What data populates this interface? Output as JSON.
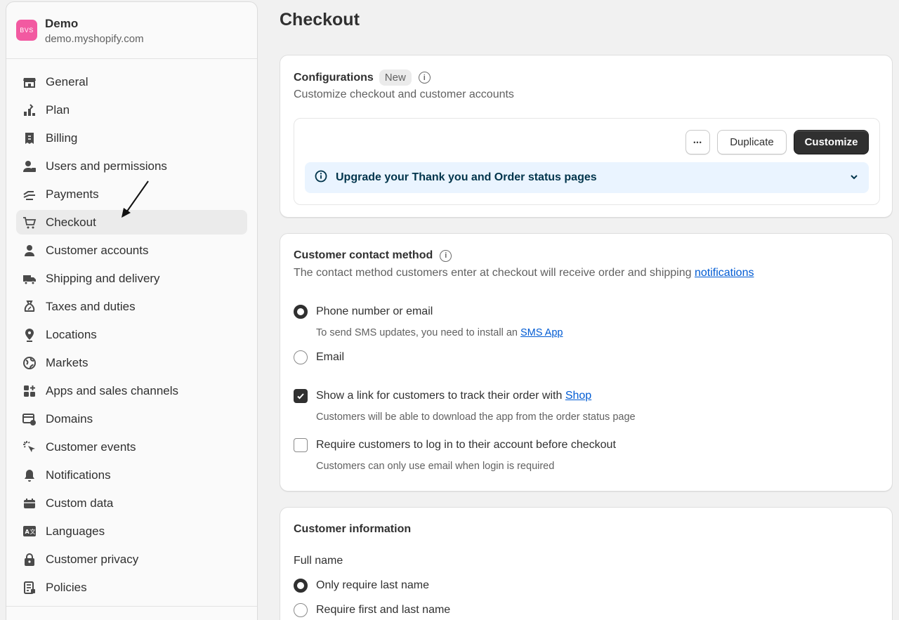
{
  "store": {
    "avatar_text": "BVS",
    "name": "Demo",
    "domain": "demo.myshopify.com",
    "avatar_color": "#f25aa1"
  },
  "sidebar": {
    "items": [
      {
        "label": "General",
        "icon": "store-icon"
      },
      {
        "label": "Plan",
        "icon": "plan-icon"
      },
      {
        "label": "Billing",
        "icon": "billing-icon"
      },
      {
        "label": "Users and permissions",
        "icon": "users-icon"
      },
      {
        "label": "Payments",
        "icon": "payments-icon"
      },
      {
        "label": "Checkout",
        "icon": "cart-icon",
        "active": true
      },
      {
        "label": "Customer accounts",
        "icon": "person-icon"
      },
      {
        "label": "Shipping and delivery",
        "icon": "truck-icon"
      },
      {
        "label": "Taxes and duties",
        "icon": "tax-icon"
      },
      {
        "label": "Locations",
        "icon": "location-icon"
      },
      {
        "label": "Markets",
        "icon": "globe-icon"
      },
      {
        "label": "Apps and sales channels",
        "icon": "apps-icon"
      },
      {
        "label": "Domains",
        "icon": "domains-icon"
      },
      {
        "label": "Customer events",
        "icon": "cursor-icon"
      },
      {
        "label": "Notifications",
        "icon": "bell-icon"
      },
      {
        "label": "Custom data",
        "icon": "database-icon"
      },
      {
        "label": "Languages",
        "icon": "language-icon"
      },
      {
        "label": "Customer privacy",
        "icon": "lock-icon"
      },
      {
        "label": "Policies",
        "icon": "policies-icon"
      }
    ]
  },
  "page": {
    "title": "Checkout"
  },
  "configurations": {
    "title": "Configurations",
    "badge": "New",
    "subtitle": "Customize checkout and customer accounts",
    "more_label": "•••",
    "duplicate_label": "Duplicate",
    "customize_label": "Customize",
    "banner_text": "Upgrade your Thank you and Order status pages"
  },
  "contact": {
    "title": "Customer contact method",
    "desc_prefix": "The contact method customers enter at checkout will receive order and shipping",
    "desc_link": "notifications",
    "opt_phone": "Phone number or email",
    "phone_help_prefix": "To send SMS updates, you need to install an",
    "phone_help_link": "SMS App",
    "opt_email": "Email",
    "track_prefix": "Show a link for customers to track their order with",
    "track_link": "Shop",
    "track_help": "Customers will be able to download the app from the order status page",
    "login_label": "Require customers to log in to their account before checkout",
    "login_help": "Customers can only use email when login is required",
    "selected": "phone",
    "track_checked": true,
    "login_checked": false
  },
  "customer_info": {
    "title": "Customer information",
    "full_name_label": "Full name",
    "opt_last": "Only require last name",
    "opt_first_last": "Require first and last name",
    "selected": "last"
  }
}
